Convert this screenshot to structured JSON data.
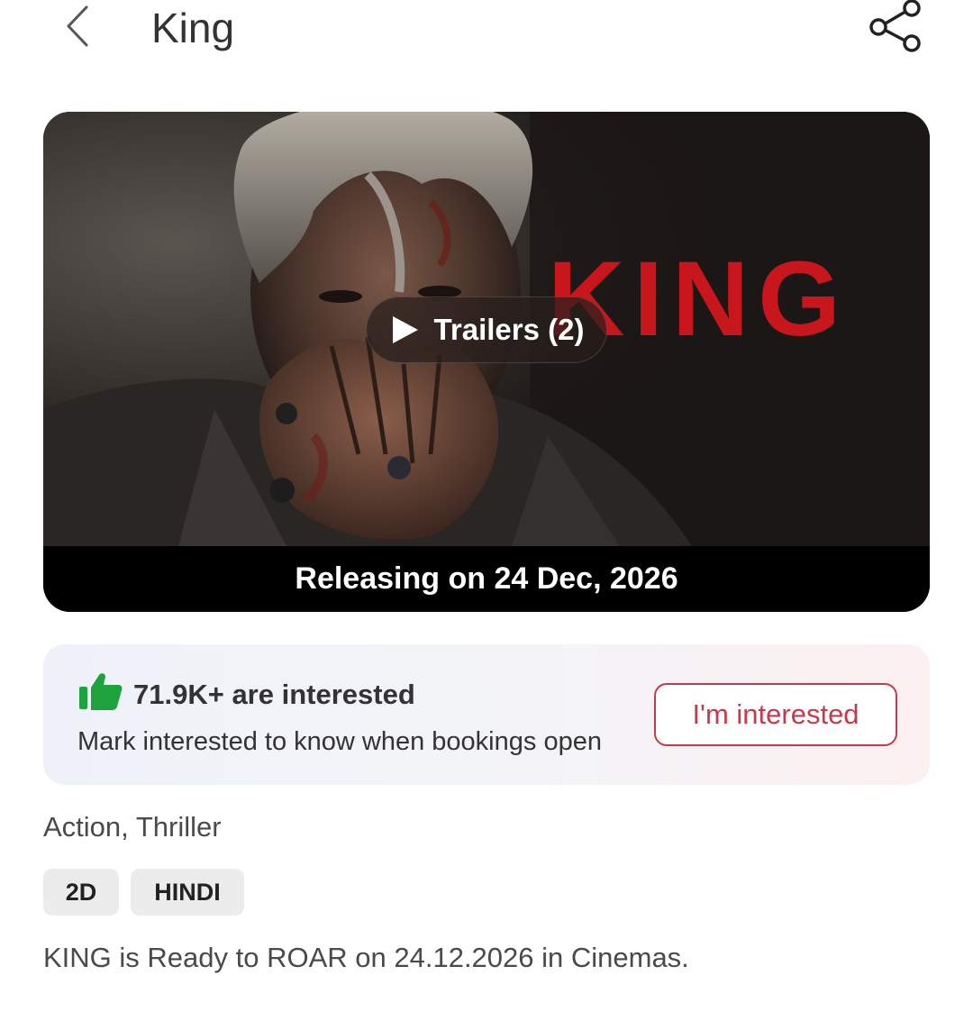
{
  "header": {
    "title": "King",
    "back_icon": "chevron-left-icon",
    "share_icon": "share-icon"
  },
  "hero": {
    "poster_title": "KING",
    "trailer_label": "Trailers (2)",
    "release_text": "Releasing on 24 Dec, 2026",
    "poster_title_color": "#c8161d"
  },
  "interest": {
    "count_text": "71.9K+ are interested",
    "subtitle": "Mark interested to know when bookings open",
    "button_label": "I'm interested",
    "thumb_icon": "thumbs-up-icon",
    "thumb_color": "#1ea33c",
    "accent_color": "#c53a4c"
  },
  "genres": "Action, Thriller",
  "tags": [
    "2D",
    "HINDI"
  ],
  "description": "KING is Ready to ROAR on 24.12.2026 in Cinemas."
}
